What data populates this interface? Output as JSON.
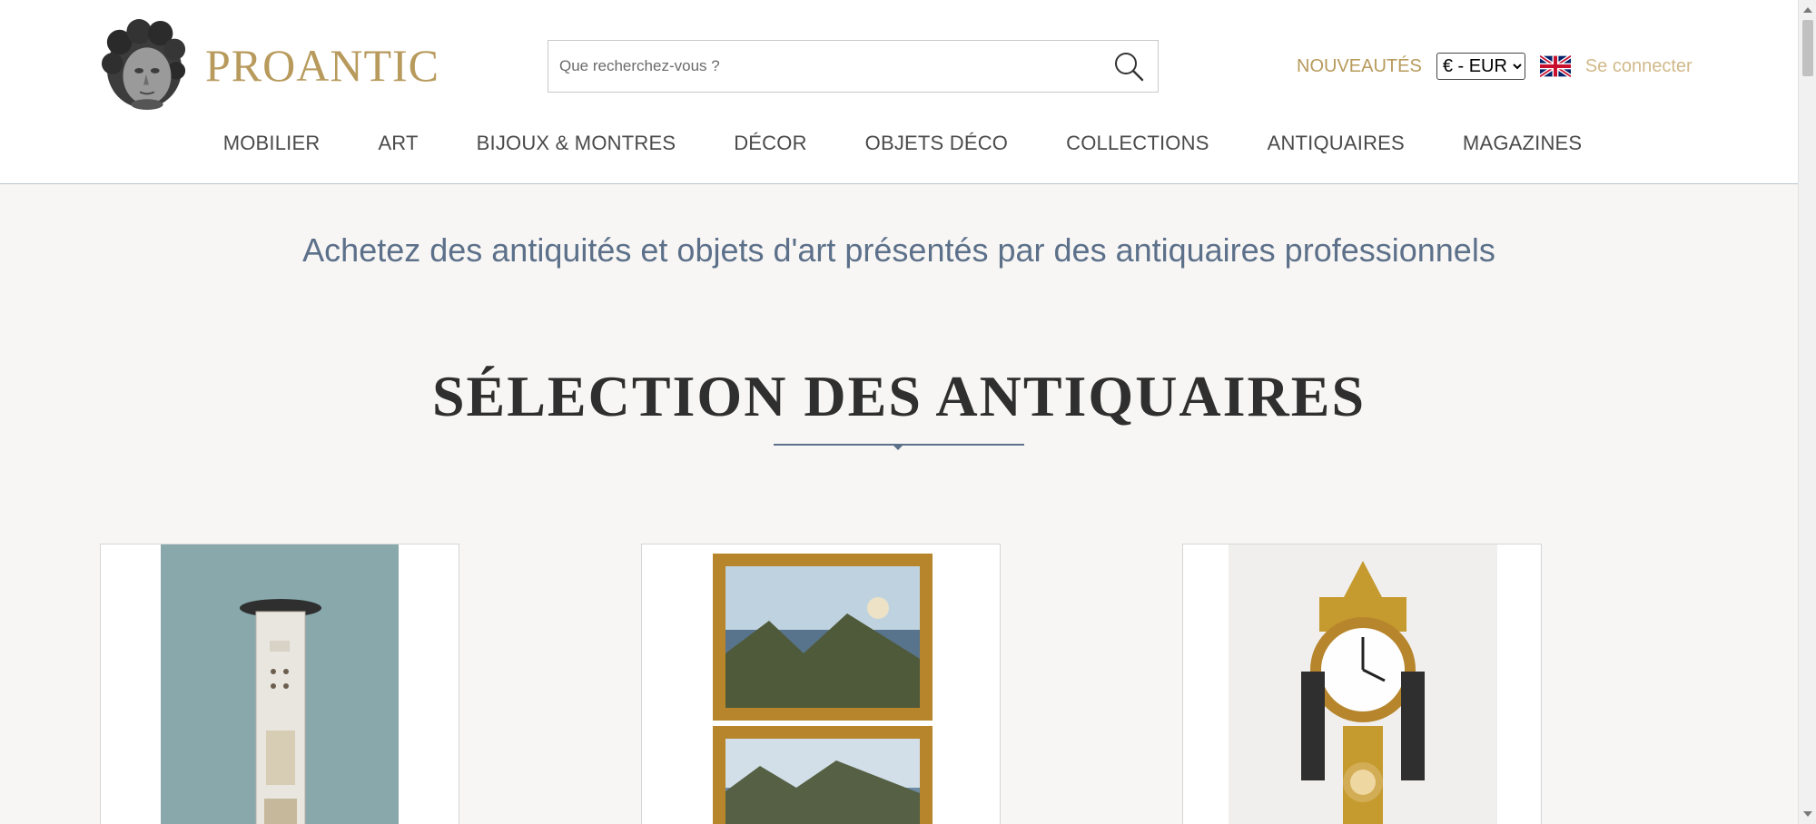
{
  "header": {
    "logo_text": "PROANTIC",
    "search_placeholder": "Que recherchez-vous ?",
    "nouveautes": "NOUVEAUTÉS",
    "currency": "€ - EUR",
    "connect": "Se connecter",
    "nav": [
      "MOBILIER",
      "ART",
      "BIJOUX & MONTRES",
      "DÉCOR",
      "OBJETS DÉCO",
      "COLLECTIONS",
      "ANTIQUAIRES",
      "MAGAZINES"
    ]
  },
  "main": {
    "tagline": "Achetez des antiquités et objets d'art présentés par des antiquaires professionnels",
    "section_title": "SÉLECTION DES ANTIQUAIRES"
  },
  "colors": {
    "brand_gold": "#b79a5c",
    "tagline_blue": "#5c708a",
    "background": "#f7f6f4"
  },
  "icons": {
    "search": "search-icon",
    "flag": "uk-flag-icon",
    "logo": "logo-head-icon"
  }
}
